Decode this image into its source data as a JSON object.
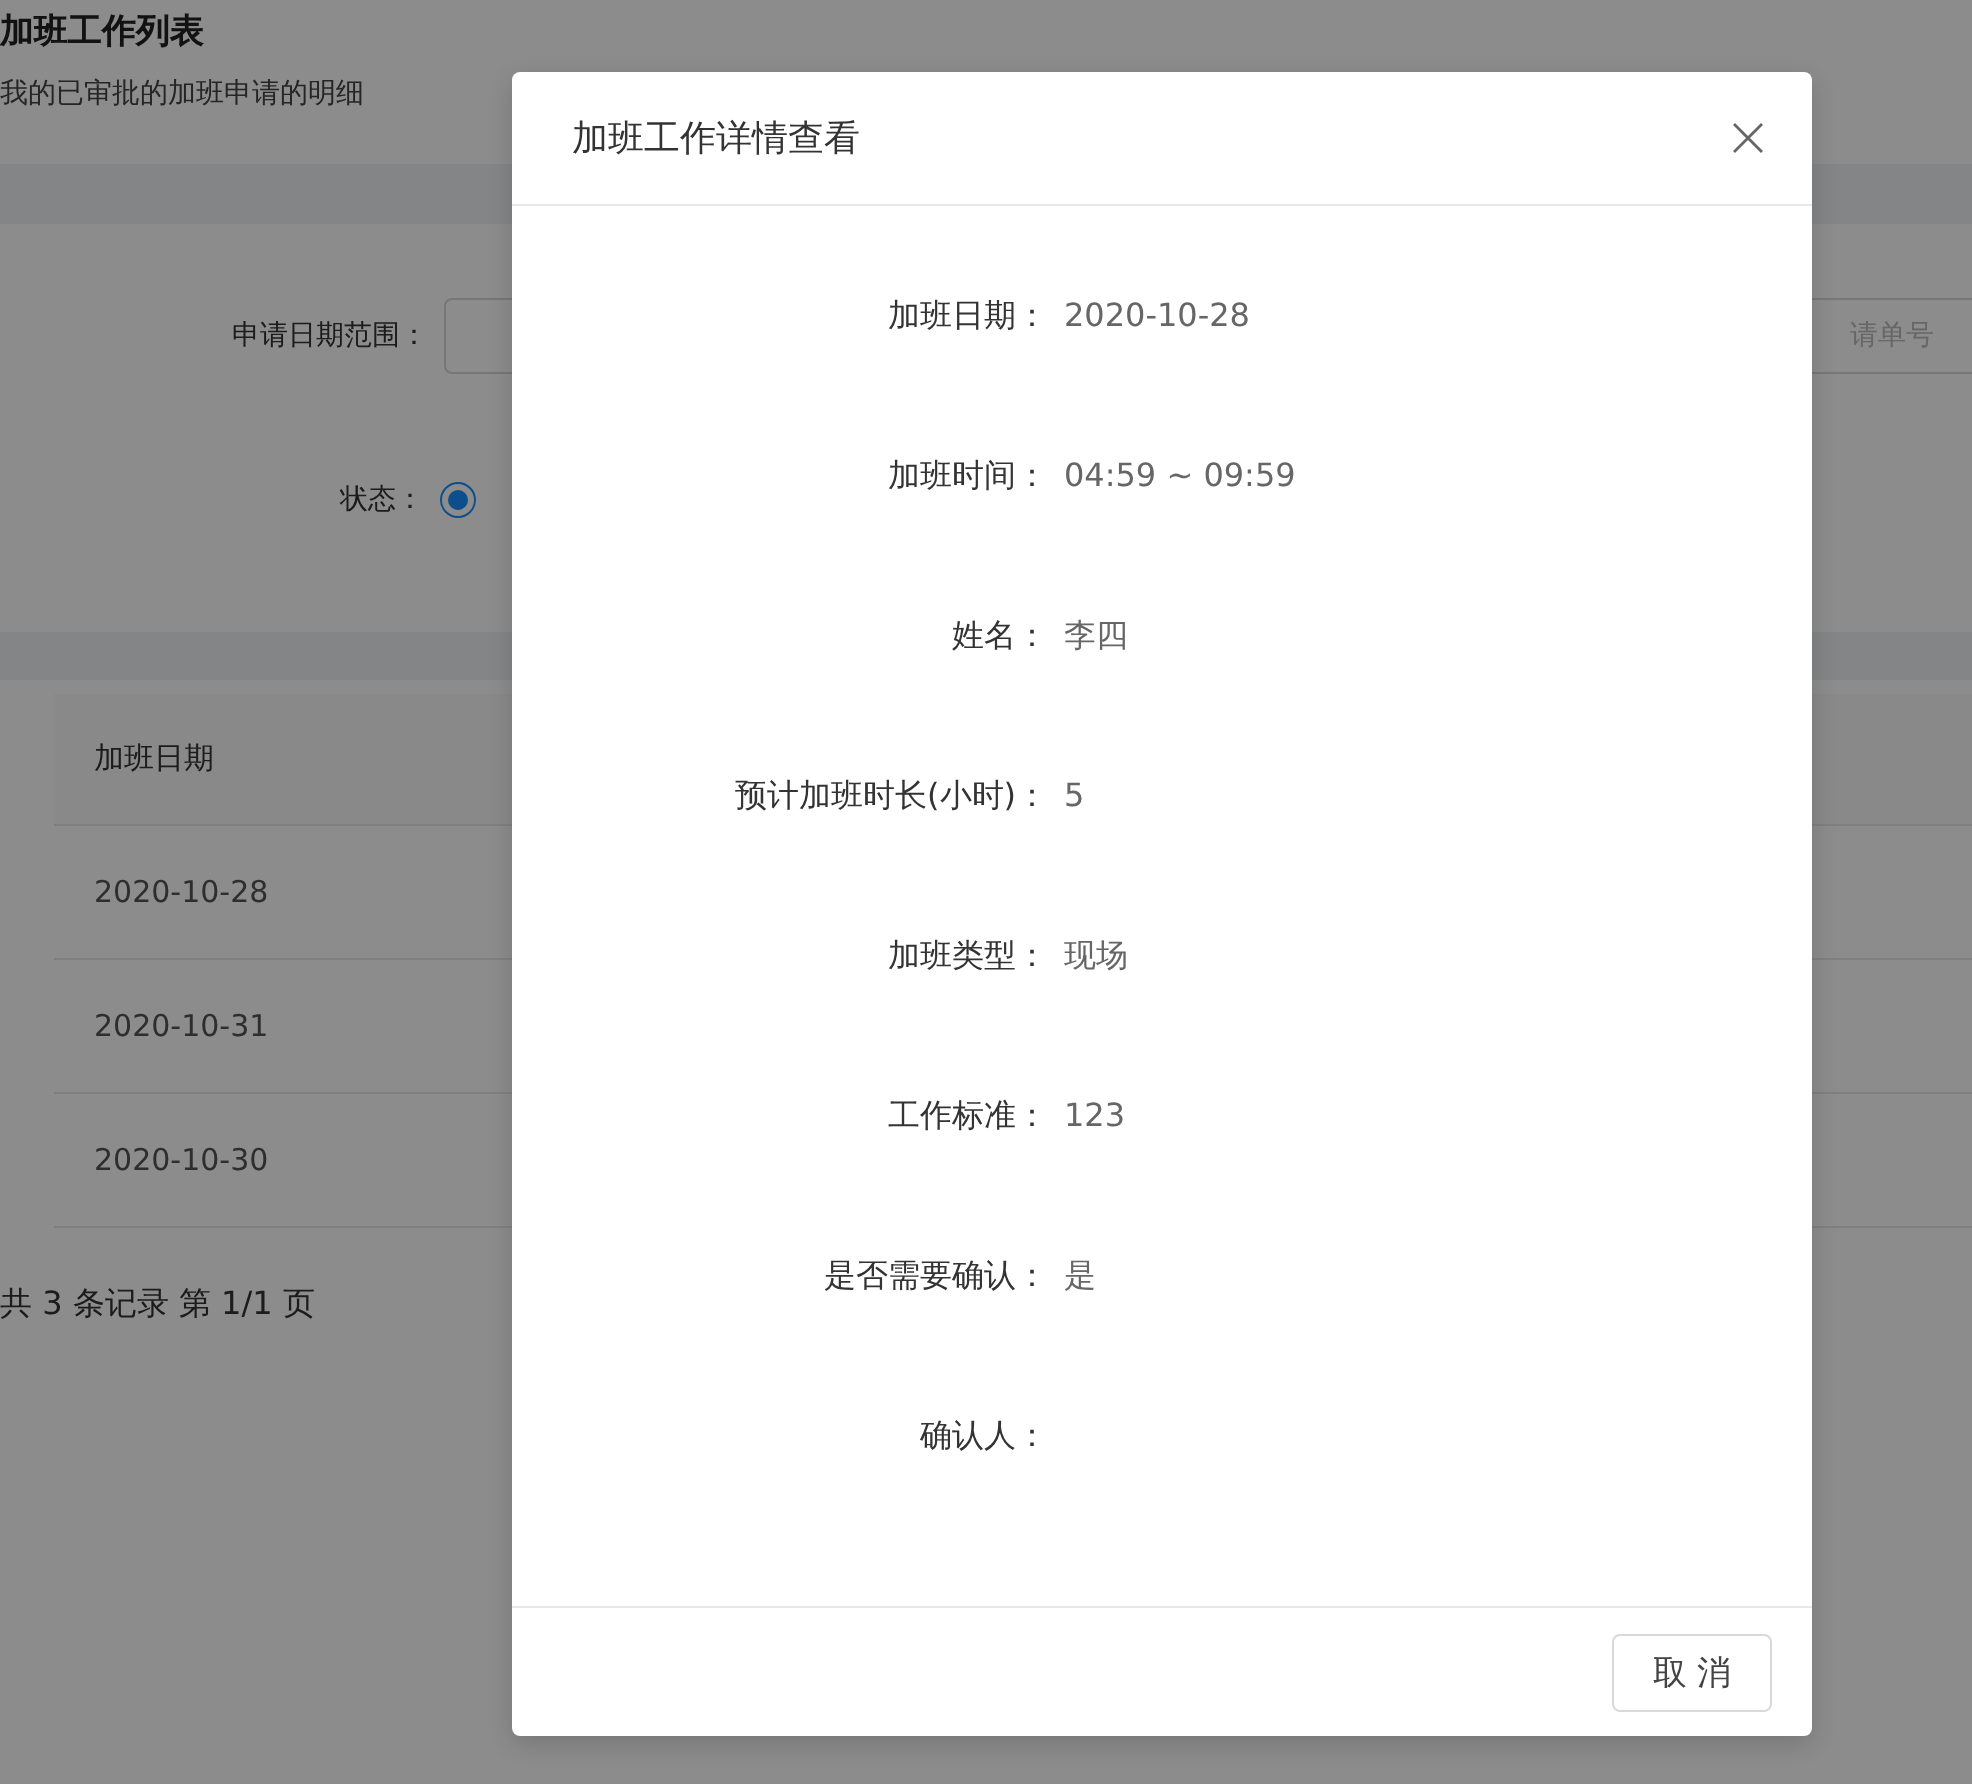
{
  "page": {
    "title": "加班工作列表",
    "subtitle": "我的已审批的加班申请的明细",
    "filters": {
      "date_range_label": "申请日期范围：",
      "status_label": "状态：",
      "status_radio": {
        "selected": true
      },
      "order_placeholder": "请单号"
    },
    "table": {
      "columns": [
        "加班日期"
      ],
      "rows": [
        [
          "2020-10-28"
        ],
        [
          "2020-10-31"
        ],
        [
          "2020-10-30"
        ]
      ]
    },
    "pagination": "共 3 条记录 第 1/1 页"
  },
  "modal": {
    "title": "加班工作详情查看",
    "fields": [
      {
        "label": "加班日期：",
        "value": "2020-10-28"
      },
      {
        "label": "加班时间：",
        "value": "04:59 ~ 09:59"
      },
      {
        "label": "姓名：",
        "value": "李四"
      },
      {
        "label": "预计加班时长(小时)：",
        "value": "5"
      },
      {
        "label": "加班类型：",
        "value": "现场"
      },
      {
        "label": "工作标准：",
        "value": "123"
      },
      {
        "label": "是否需要确认：",
        "value": "是"
      },
      {
        "label": "确认人："
      }
    ],
    "cancel_button": "取 消"
  }
}
